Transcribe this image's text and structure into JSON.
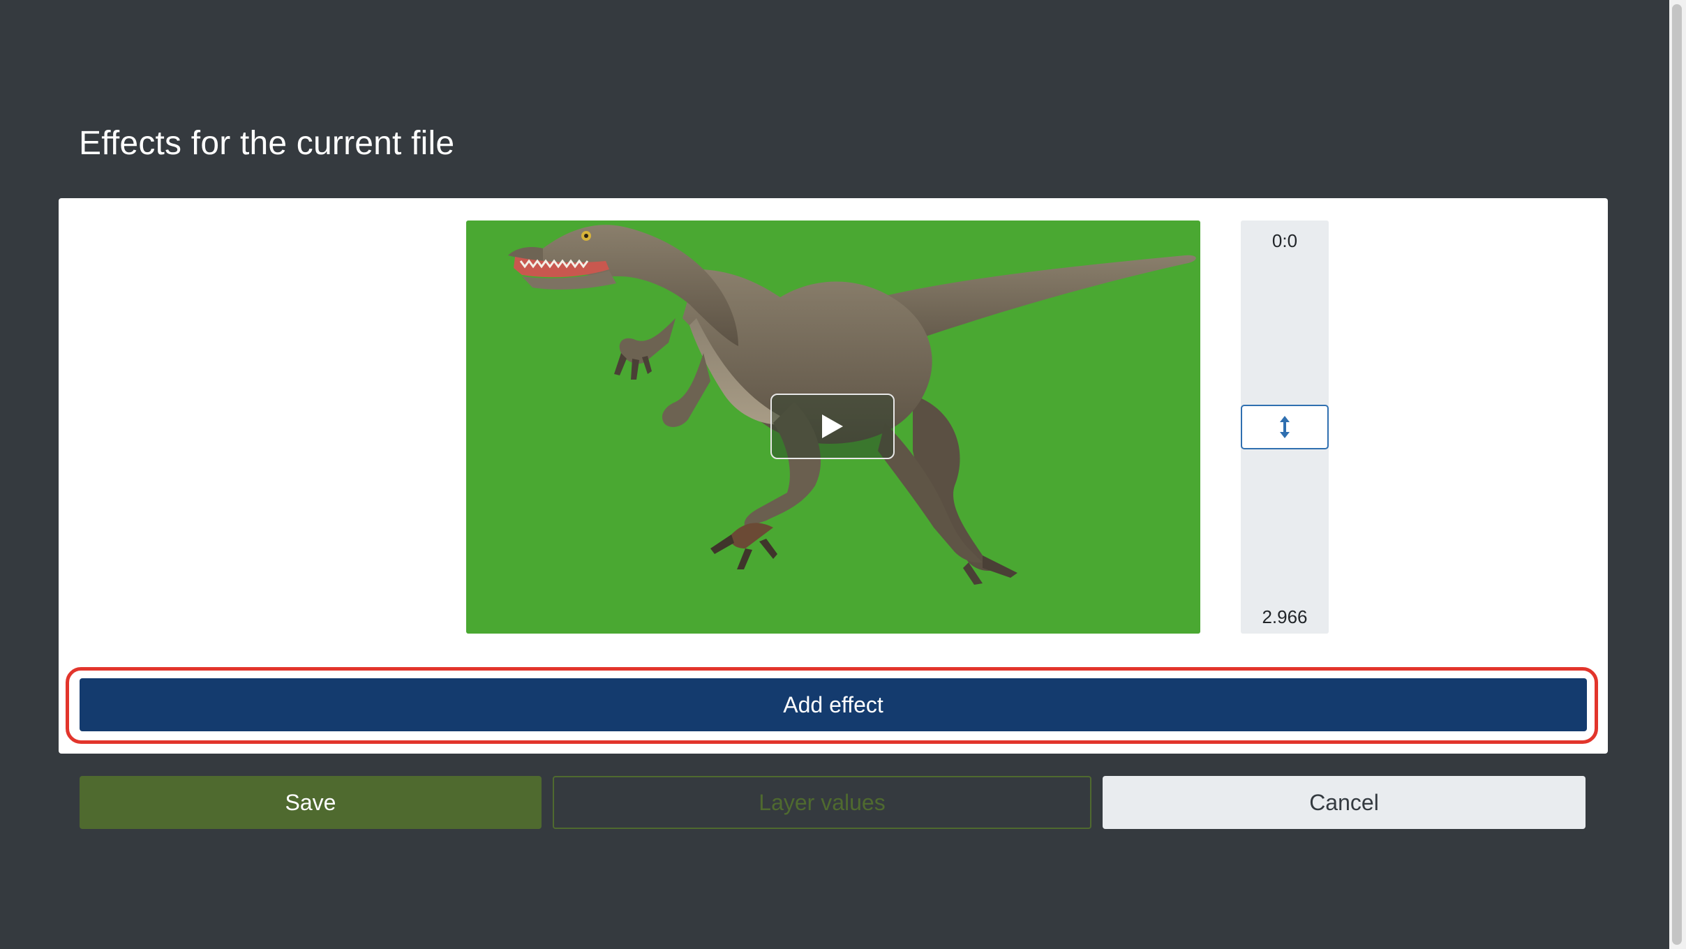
{
  "dialog": {
    "title": "Effects for the current file"
  },
  "preview": {
    "play_icon": "play-icon",
    "subject": "raptor-on-green-screen"
  },
  "timeline": {
    "start_label": "0:0",
    "end_label": "2.966",
    "handle_icon": "vertical-resize-arrows-icon"
  },
  "actions": {
    "add_effect_label": "Add effect"
  },
  "footer": {
    "save_label": "Save",
    "layer_values_label": "Layer values",
    "cancel_label": "Cancel"
  },
  "colors": {
    "backdrop": "#353a3f",
    "panel": "#ffffff",
    "green_screen": "#4aa832",
    "primary_button": "#143b6e",
    "save_button": "#4f6a2f",
    "highlight": "#e2352c",
    "cancel_button": "#e9ecef"
  }
}
